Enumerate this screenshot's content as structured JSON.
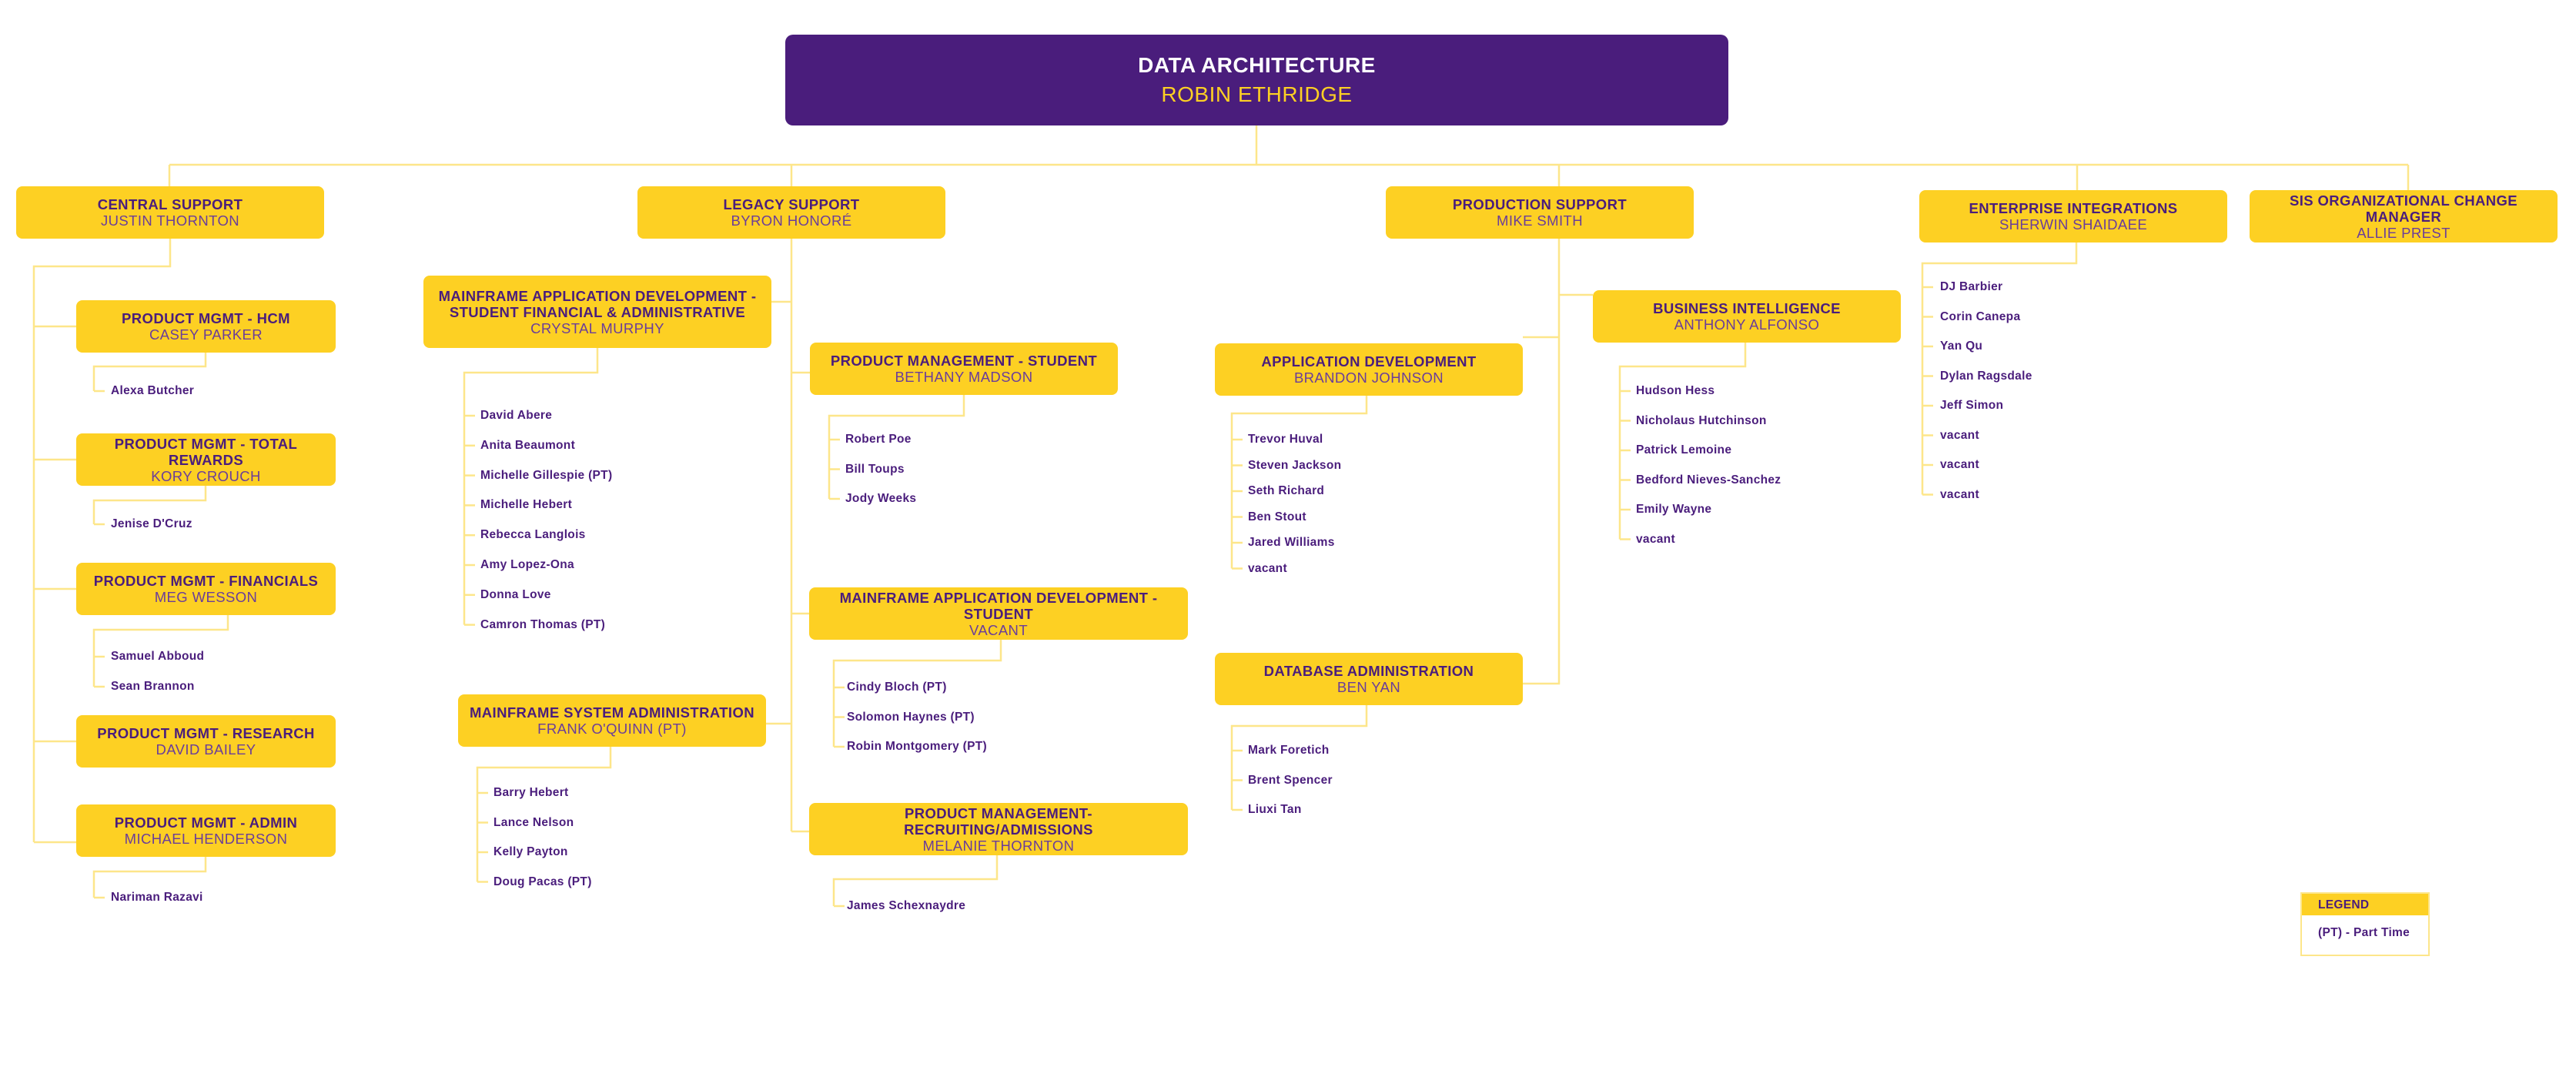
{
  "colors": {
    "root_bg": "#4a1d7c",
    "node_bg": "#fdd023",
    "title_text": "#4a1d7c",
    "name_text": "#6a3d9a",
    "root_title": "#ffffff",
    "root_name": "#fdd023",
    "connector": "#fde68a"
  },
  "root": {
    "title": "DATA ARCHITECTURE",
    "name": "ROBIN ETHRIDGE"
  },
  "departments": [
    {
      "id": "central",
      "title": "CENTRAL SUPPORT",
      "name": "JUSTIN THORNTON",
      "teams": [
        {
          "id": "hcm",
          "title": "PRODUCT MGMT - HCM",
          "name": "CASEY PARKER",
          "members": [
            "Alexa Butcher"
          ]
        },
        {
          "id": "total-rewards",
          "title": "PRODUCT MGMT - TOTAL REWARDS",
          "name": "KORY CROUCH",
          "members": [
            "Jenise D'Cruz"
          ]
        },
        {
          "id": "financials",
          "title": "PRODUCT MGMT - FINANCIALS",
          "name": "MEG WESSON",
          "members": [
            "Samuel Abboud",
            "Sean Brannon"
          ]
        },
        {
          "id": "research",
          "title": "PRODUCT MGMT - RESEARCH",
          "name": "DAVID BAILEY",
          "members": []
        },
        {
          "id": "admin",
          "title": "PRODUCT MGMT - ADMIN",
          "name": "MICHAEL HENDERSON",
          "members": [
            "Nariman Razavi"
          ]
        }
      ]
    },
    {
      "id": "legacy",
      "title": "LEGACY SUPPORT",
      "name": "BYRON HONORÉ",
      "teams": [
        {
          "id": "mf-app-dev-sfa",
          "title": "MAINFRAME APPLICATION  DEVELOPMENT -\nSTUDENT FINANCIAL & ADMINISTRATIVE",
          "name": "CRYSTAL MURPHY",
          "members": [
            "David Abere",
            "Anita Beaumont",
            "Michelle Gillespie (PT)",
            "Michelle Hebert",
            "Rebecca Langlois",
            "Amy Lopez-Ona",
            "Donna Love",
            "Camron Thomas (PT)"
          ]
        },
        {
          "id": "pm-student",
          "title": "PRODUCT MANAGEMENT - STUDENT",
          "name": "BETHANY MADSON",
          "members": [
            "Robert Poe",
            "Bill Toups",
            "Jody Weeks"
          ]
        },
        {
          "id": "mf-app-dev-student",
          "title": "MAINFRAME APPLICATION DEVELOPMENT - STUDENT",
          "name": "VACANT",
          "members": [
            "Cindy Bloch (PT)",
            "Solomon Haynes (PT)",
            "Robin Montgomery (PT)"
          ]
        },
        {
          "id": "mf-sys-admin",
          "title": "MAINFRAME SYSTEM ADMINISTRATION",
          "name": "FRANK O'QUINN (PT)",
          "members": [
            "Barry Hebert",
            "Lance Nelson",
            "Kelly Payton",
            "Doug Pacas (PT)"
          ]
        },
        {
          "id": "pm-recruiting",
          "title": "PRODUCT MANAGEMENT- RECRUITING/ADMISSIONS",
          "name": "MELANIE THORNTON",
          "members": [
            "James Schexnaydre"
          ]
        }
      ]
    },
    {
      "id": "production",
      "title": "PRODUCTION SUPPORT",
      "name": "MIKE SMITH",
      "teams": [
        {
          "id": "bi",
          "title": "BUSINESS INTELLIGENCE",
          "name": "ANTHONY ALFONSO",
          "members": [
            "Hudson Hess",
            "Nicholaus Hutchinson",
            "Patrick Lemoine",
            "Bedford Nieves-Sanchez",
            "Emily Wayne",
            "vacant"
          ]
        },
        {
          "id": "app-dev",
          "title": "APPLICATION DEVELOPMENT",
          "name": "BRANDON JOHNSON",
          "members": [
            "Trevor Huval",
            "Steven Jackson",
            "Seth Richard",
            "Ben Stout",
            "Jared Williams",
            "vacant"
          ]
        },
        {
          "id": "dba",
          "title": "DATABASE ADMINISTRATION",
          "name": "BEN YAN",
          "members": [
            "Mark Foretich",
            "Brent Spencer",
            "Liuxi Tan"
          ]
        }
      ]
    },
    {
      "id": "enterprise",
      "title": "ENTERPRISE INTEGRATIONS",
      "name": "SHERWIN SHAIDAEE",
      "members": [
        "DJ Barbier",
        "Corin Canepa",
        "Yan Qu",
        "Dylan Ragsdale",
        "Jeff Simon",
        "vacant",
        "vacant",
        "vacant"
      ]
    },
    {
      "id": "sis",
      "title": "SIS ORGANIZATIONAL CHANGE MANAGER",
      "name": "ALLIE PREST",
      "members": []
    }
  ],
  "legend": {
    "title": "LEGEND",
    "items": [
      "(PT) - Part Time"
    ]
  }
}
